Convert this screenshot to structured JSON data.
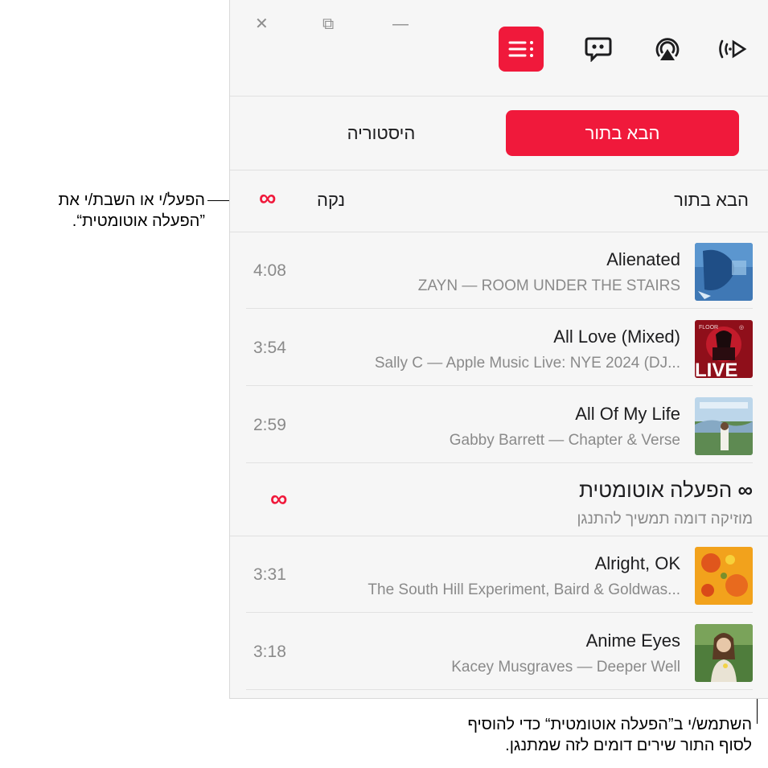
{
  "callouts": {
    "autoplay_toggle": [
      "הפעל/י או השבת/י את",
      "”הפעלה אוטומטית“."
    ],
    "autoplay_section": [
      "השתמש/י ב”הפעלה אוטומטית“ כדי להוסיף",
      "לסוף התור שירים דומים לזה שמתנגן."
    ]
  },
  "window": {
    "close_glyph": "✕",
    "restore_glyph": "⧉",
    "minimize_glyph": "—"
  },
  "toolbar": {
    "items": [
      {
        "name": "queue",
        "icon": "list-icon",
        "active": true
      },
      {
        "name": "lyrics",
        "icon": "lyrics-bubble-icon",
        "active": false
      },
      {
        "name": "airplay",
        "icon": "airplay-icon",
        "active": false
      },
      {
        "name": "broadcast",
        "icon": "broadcast-icon",
        "active": false
      }
    ]
  },
  "tabs": {
    "up_next": "הבא בתור",
    "history": "היסטוריה"
  },
  "queue": {
    "title": "הבא בתור",
    "clear": "נקה",
    "autoplay_symbol": "∞"
  },
  "tracks": [
    {
      "title": "Alienated",
      "subtitle": "ZAYN — ROOM UNDER THE STAIRS",
      "duration": "4:08"
    },
    {
      "title": "All Love (Mixed)",
      "subtitle": "Sally C — Apple Music Live: NYE 2024 (DJ...",
      "duration": "3:54"
    },
    {
      "title": "All Of My Life",
      "subtitle": "Gabby Barrett — Chapter & Verse",
      "duration": "2:59"
    }
  ],
  "autoplay": {
    "title": "הפעלה אוטומטית",
    "subtitle": "מוזיקה דומה תמשיך להתנגן",
    "symbol": "∞"
  },
  "autoplay_tracks": [
    {
      "title": "Alright, OK",
      "subtitle": "The South Hill Experiment, Baird & Goldwas...",
      "duration": "3:31"
    },
    {
      "title": "Anime Eyes",
      "subtitle": "Kacey Musgraves — Deeper Well",
      "duration": "3:18"
    }
  ],
  "art_text": {
    "live": "LIVE"
  },
  "colors": {
    "accent": "#f0193b",
    "secondary_text": "#8a8a8a"
  }
}
